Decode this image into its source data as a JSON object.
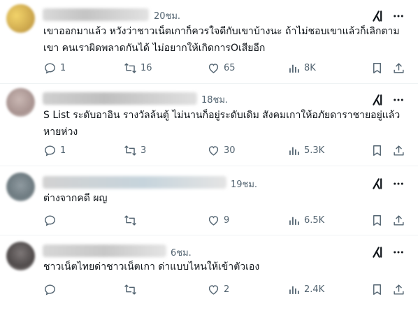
{
  "tweets": [
    {
      "time": "20ชม.",
      "text": "เขาออกมาแล้ว หวังว่าชาวเน็ตเกาก็ควรใจดีกับเขาบ้างนะ ถ้าไม่ชอบเขาแล้วก็เลิกตาม\nเขา คนเราผิดพลาดกันได้ ไม่อยากให้เกิดการOเสียอีก",
      "replies": "1",
      "reposts": "16",
      "likes": "65",
      "views": "8K"
    },
    {
      "time": "18ชม.",
      "text": "S List ระดับอาอิน รางวัลล้นตู้ ไม่นานก็อยู่ระดับเดิม สังคมเกาให้อภัยดาราชายอยู่แล้ว\nหายห่วง",
      "replies": "1",
      "reposts": "3",
      "likes": "30",
      "views": "5.3K"
    },
    {
      "time": "19ชม.",
      "text": "ต่างจากคดี ผญ",
      "replies": "",
      "reposts": "",
      "likes": "9",
      "views": "6.5K"
    },
    {
      "time": "6ชม.",
      "text": "ชาวเน็ตไทยด่าชาวเน็ตเกา ด่าแบบไหนให้เข้าตัวเอง",
      "replies": "",
      "reposts": "",
      "likes": "2",
      "views": "2.4K"
    }
  ],
  "icons": {
    "reply": "reply-icon",
    "repost": "repost-icon",
    "like": "heart-icon",
    "views": "views-icon",
    "bookmark": "bookmark-icon",
    "share": "share-icon",
    "grok": "grok-icon",
    "more": "more-icon"
  },
  "colors": {
    "text": "#0f1419",
    "muted": "#536471",
    "divider": "#eff3f4"
  }
}
